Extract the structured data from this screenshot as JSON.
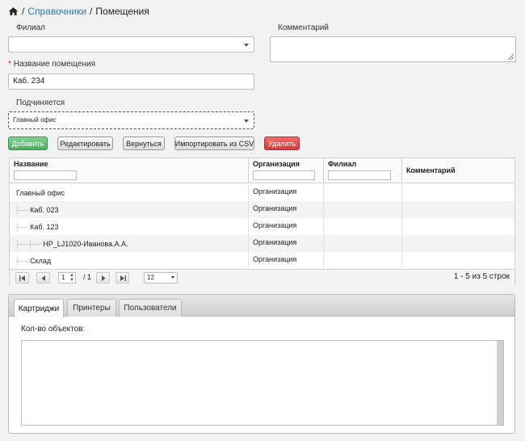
{
  "breadcrumb": {
    "home_icon": "home-icon",
    "sep1": "/",
    "link": "Справочники",
    "sep2": "/",
    "current": "Помещения"
  },
  "form": {
    "branch_label": "Филиал",
    "branch_value": "",
    "comment_label": "Комментарий",
    "comment_value": "",
    "name_required_mark": "*",
    "name_label": "Название помещения",
    "name_value": "Каб. 234",
    "parent_label": "Подчиняется",
    "parent_value": "Главный офис"
  },
  "buttons": {
    "add": "Добавить",
    "edit": "Редактировать",
    "back": "Вернуться",
    "import_csv": "Импортировать из CSV",
    "delete": "Удалить"
  },
  "colors": {
    "link": "#2a7ab5",
    "add_button": "#5cb86b",
    "delete_button": "#e04a4a",
    "required": "#d9352b"
  },
  "grid": {
    "columns": [
      "Название",
      "Организация",
      "Филиал",
      "Комментарий"
    ],
    "rows": [
      {
        "name": "Главный офис",
        "org": "Организация",
        "branch": "",
        "comment": "",
        "level": 0
      },
      {
        "name": "Каб. 023",
        "org": "Организация",
        "branch": "",
        "comment": "",
        "level": 1
      },
      {
        "name": "Каб. 123",
        "org": "Организация",
        "branch": "",
        "comment": "",
        "level": 1
      },
      {
        "name": "HP_LJ1020-Иванова.А.А.",
        "org": "Организация",
        "branch": "",
        "comment": "",
        "level": 2
      },
      {
        "name": "Склад",
        "org": "Организация",
        "branch": "",
        "comment": "",
        "level": 1
      }
    ],
    "pager": {
      "page": "1",
      "total": "/ 1",
      "page_size": "12",
      "summary": "1 - 5 из 5 строк"
    }
  },
  "tabs": {
    "items": [
      "Картриджи",
      "Принтеры",
      "Пользователи"
    ],
    "active": "Картриджи",
    "count_label": "Кол-во объектов:"
  }
}
